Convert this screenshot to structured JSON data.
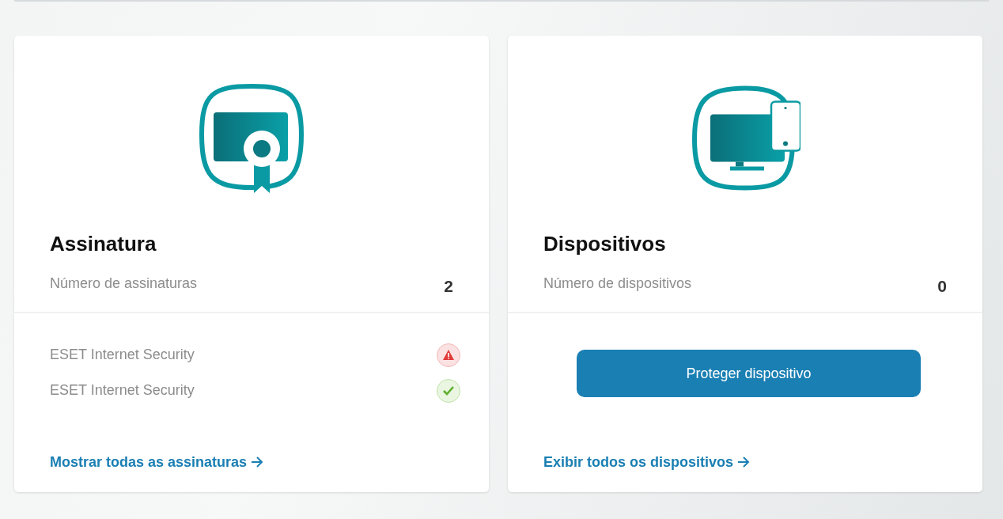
{
  "cards": [
    {
      "kind": "subscriptions",
      "title": "Assinatura",
      "count_label": "Número de assinaturas",
      "count": "2",
      "items": [
        {
          "label": "ESET Internet Security",
          "kind": "warning"
        },
        {
          "label": "ESET Internet Security",
          "kind": "ok"
        }
      ],
      "link": "Mostrar todas as assinaturas"
    },
    {
      "kind": "devices",
      "title": "Dispositivos",
      "count_label": "Número de dispositivos",
      "count": "0",
      "button": "Proteger dispositivo",
      "link": "Exibir todos os dispositivos"
    }
  ]
}
